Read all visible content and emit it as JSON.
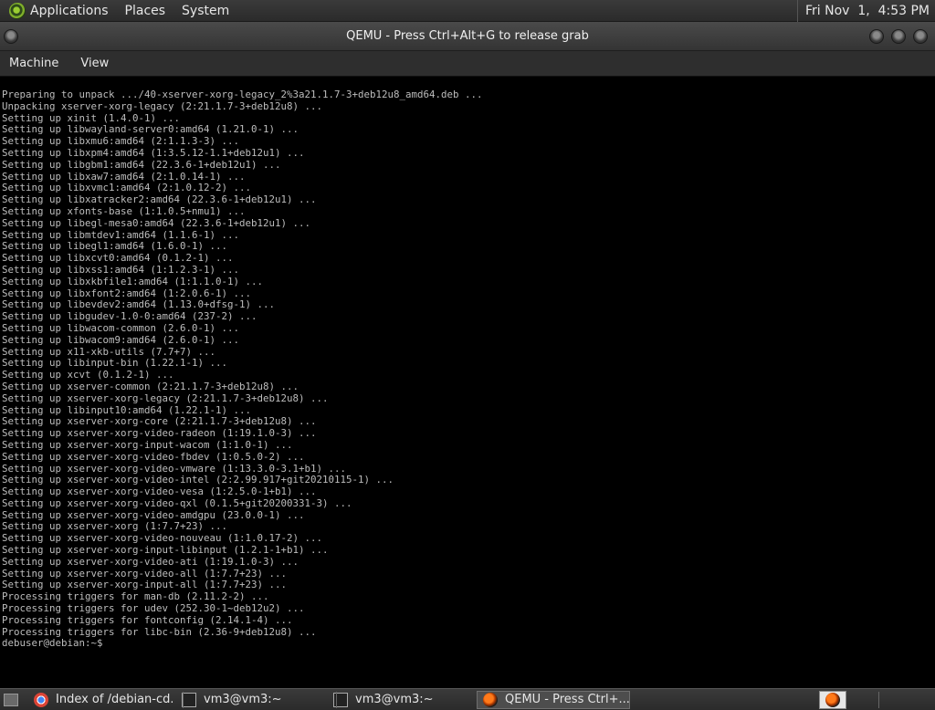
{
  "top_panel": {
    "menus": [
      "Applications",
      "Places",
      "System"
    ],
    "clock": "Fri Nov  1,  4:53 PM"
  },
  "window": {
    "title": "QEMU - Press Ctrl+Alt+G to release grab"
  },
  "menubar": {
    "items": [
      "Machine",
      "View"
    ]
  },
  "console": {
    "lines": [
      "Preparing to unpack .../40-xserver-xorg-legacy_2%3a21.1.7-3+deb12u8_amd64.deb ...",
      "Unpacking xserver-xorg-legacy (2:21.1.7-3+deb12u8) ...",
      "Setting up xinit (1.4.0-1) ...",
      "Setting up libwayland-server0:amd64 (1.21.0-1) ...",
      "Setting up libxmu6:amd64 (2:1.1.3-3) ...",
      "Setting up libxpm4:amd64 (1:3.5.12-1.1+deb12u1) ...",
      "Setting up libgbm1:amd64 (22.3.6-1+deb12u1) ...",
      "Setting up libxaw7:amd64 (2:1.0.14-1) ...",
      "Setting up libxvmc1:amd64 (2:1.0.12-2) ...",
      "Setting up libxatracker2:amd64 (22.3.6-1+deb12u1) ...",
      "Setting up xfonts-base (1:1.0.5+nmu1) ...",
      "Setting up libegl-mesa0:amd64 (22.3.6-1+deb12u1) ...",
      "Setting up libmtdev1:amd64 (1.1.6-1) ...",
      "Setting up libegl1:amd64 (1.6.0-1) ...",
      "Setting up libxcvt0:amd64 (0.1.2-1) ...",
      "Setting up libxss1:amd64 (1:1.2.3-1) ...",
      "Setting up libxkbfile1:amd64 (1:1.1.0-1) ...",
      "Setting up libxfont2:amd64 (1:2.0.6-1) ...",
      "Setting up libevdev2:amd64 (1.13.0+dfsg-1) ...",
      "Setting up libgudev-1.0-0:amd64 (237-2) ...",
      "Setting up libwacom-common (2.6.0-1) ...",
      "Setting up libwacom9:amd64 (2.6.0-1) ...",
      "Setting up x11-xkb-utils (7.7+7) ...",
      "Setting up libinput-bin (1.22.1-1) ...",
      "Setting up xcvt (0.1.2-1) ...",
      "Setting up xserver-common (2:21.1.7-3+deb12u8) ...",
      "Setting up xserver-xorg-legacy (2:21.1.7-3+deb12u8) ...",
      "Setting up libinput10:amd64 (1.22.1-1) ...",
      "Setting up xserver-xorg-core (2:21.1.7-3+deb12u8) ...",
      "Setting up xserver-xorg-video-radeon (1:19.1.0-3) ...",
      "Setting up xserver-xorg-input-wacom (1:1.0-1) ...",
      "Setting up xserver-xorg-video-fbdev (1:0.5.0-2) ...",
      "Setting up xserver-xorg-video-vmware (1:13.3.0-3.1+b1) ...",
      "Setting up xserver-xorg-video-intel (2:2.99.917+git20210115-1) ...",
      "Setting up xserver-xorg-video-vesa (1:2.5.0-1+b1) ...",
      "Setting up xserver-xorg-video-qxl (0.1.5+git20200331-3) ...",
      "Setting up xserver-xorg-video-amdgpu (23.0.0-1) ...",
      "Setting up xserver-xorg (1:7.7+23) ...",
      "Setting up xserver-xorg-video-nouveau (1:1.0.17-2) ...",
      "Setting up xserver-xorg-input-libinput (1.2.1-1+b1) ...",
      "Setting up xserver-xorg-video-ati (1:19.1.0-3) ...",
      "Setting up xserver-xorg-video-all (1:7.7+23) ...",
      "Setting up xserver-xorg-input-all (1:7.7+23) ...",
      "Processing triggers for man-db (2.11.2-2) ...",
      "Processing triggers for udev (252.30-1~deb12u2) ...",
      "Processing triggers for fontconfig (2.14.1-4) ...",
      "Processing triggers for libc-bin (2.36-9+deb12u8) ...",
      "debuser@debian:~$"
    ]
  },
  "taskbar": {
    "tasks": [
      {
        "label": "Index of /debian-cd...",
        "icon": "chrome-icon"
      },
      {
        "label": "vm3@vm3:~",
        "icon": "terminal-icon"
      },
      {
        "label": "vm3@vm3:~",
        "icon": "terminal-icon"
      },
      {
        "label": "QEMU - Press Ctrl+...",
        "icon": "qemu-icon"
      }
    ]
  }
}
